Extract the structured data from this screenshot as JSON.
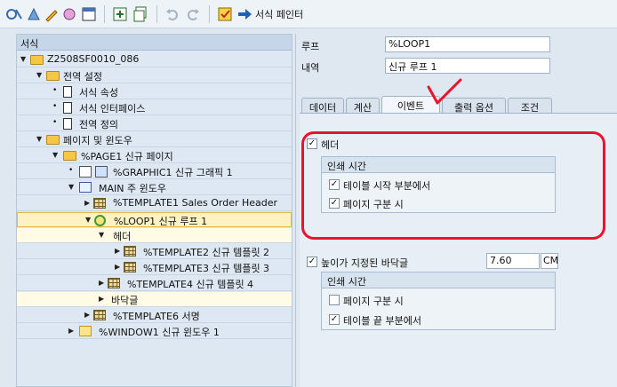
{
  "toolbar": {
    "label": "서식 페인터"
  },
  "tree": {
    "header": "서식",
    "rows": [
      "Z2508SF0010_086",
      "전역 설정",
      "서식 속성",
      "서식 인터페이스",
      "전역 정의",
      "페이지 및 윈도우",
      "%PAGE1 신규 페이지",
      "%GRAPHIC1 신규 그래픽 1",
      "MAIN 주 윈도우",
      "%TEMPLATE1 Sales Order Header",
      "%LOOP1 신규 루프 1",
      "헤더",
      "%TEMPLATE2 신규 템플릿 2",
      "%TEMPLATE3 신규 템플릿 3",
      "%TEMPLATE4 신규 템플릿 4",
      "바닥글",
      "%TEMPLATE6 서명",
      "%WINDOW1 신규 윈도우 1"
    ]
  },
  "props": {
    "loop_label": "루프",
    "loop_value": "%LOOP1",
    "desc_label": "내역",
    "desc_value": "신규 루프 1"
  },
  "tabs": [
    "데이터",
    "계산",
    "이벤트",
    "출력 옵션",
    "조건"
  ],
  "events": {
    "header_check": "헤더",
    "header_group_title": "인쇄 시간",
    "header_opt1": "테이블 시작 부분에서",
    "header_opt2": "페이지 구분 시",
    "footer_check": "높이가 지정된 바닥글",
    "footer_height": "7.60",
    "footer_unit": "CM",
    "footer_group_title": "인쇄 시간",
    "footer_opt1": "페이지 구분 시",
    "footer_opt2": "테이블 끝 부분에서"
  },
  "colors": {
    "annotation": "#e8142c",
    "selected_row": "#fff2c2"
  }
}
